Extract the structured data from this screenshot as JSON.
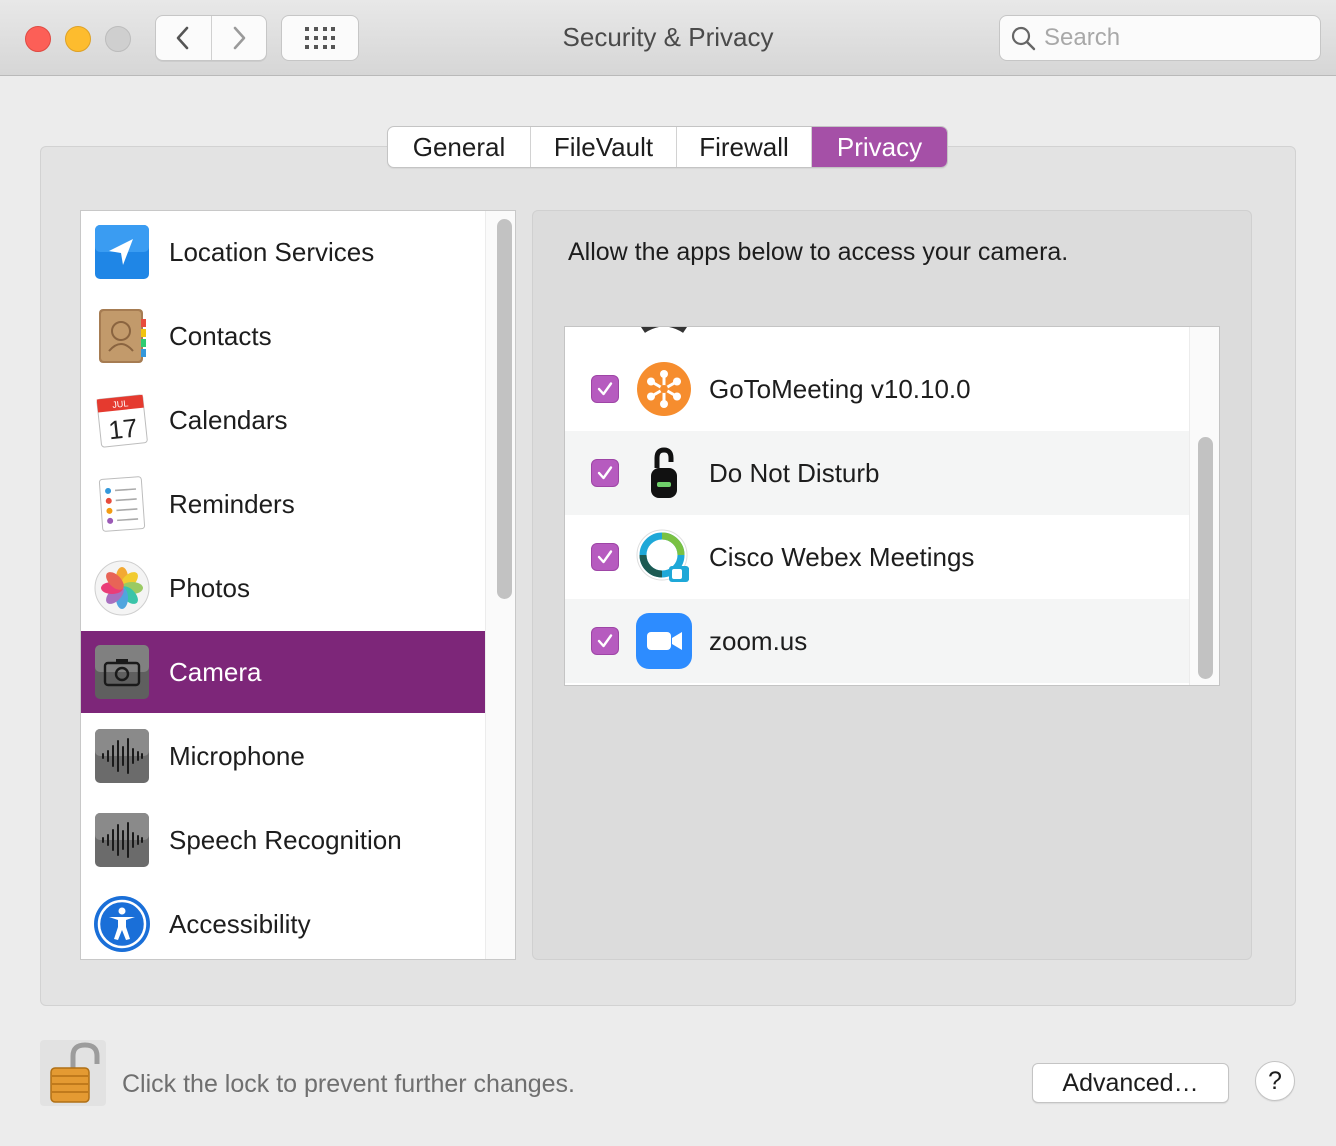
{
  "window": {
    "title": "Security & Privacy",
    "search_placeholder": "Search"
  },
  "tabs": [
    {
      "label": "General",
      "active": false
    },
    {
      "label": "FileVault",
      "active": false
    },
    {
      "label": "Firewall",
      "active": false
    },
    {
      "label": "Privacy",
      "active": true
    }
  ],
  "categories": [
    {
      "label": "Location Services",
      "icon": "location-arrow-icon",
      "selected": false
    },
    {
      "label": "Contacts",
      "icon": "contacts-book-icon",
      "selected": false
    },
    {
      "label": "Calendars",
      "icon": "calendar-icon",
      "calendar_month": "JUL",
      "calendar_day": "17",
      "selected": false
    },
    {
      "label": "Reminders",
      "icon": "reminders-icon",
      "selected": false
    },
    {
      "label": "Photos",
      "icon": "photos-flower-icon",
      "selected": false
    },
    {
      "label": "Camera",
      "icon": "camera-icon",
      "selected": true
    },
    {
      "label": "Microphone",
      "icon": "waveform-icon",
      "selected": false
    },
    {
      "label": "Speech Recognition",
      "icon": "waveform-icon",
      "selected": false
    },
    {
      "label": "Accessibility",
      "icon": "accessibility-icon",
      "selected": false
    }
  ],
  "camera_pane": {
    "description": "Allow the apps below to access your camera.",
    "apps": [
      {
        "name": "GoToMeeting v10.10.0",
        "icon": "gotomeeting-icon",
        "checked": true
      },
      {
        "name": "Do Not Disturb",
        "icon": "do-not-disturb-icon",
        "checked": true
      },
      {
        "name": "Cisco Webex Meetings",
        "icon": "webex-icon",
        "checked": true
      },
      {
        "name": "zoom.us",
        "icon": "zoom-icon",
        "checked": true
      }
    ]
  },
  "footer": {
    "lock_text": "Click the lock to prevent further changes.",
    "advanced_label": "Advanced…",
    "help_label": "?"
  },
  "colors": {
    "accent": "#a550a7",
    "selected_row": "#7d2679",
    "checkbox": "#b65bbf"
  }
}
